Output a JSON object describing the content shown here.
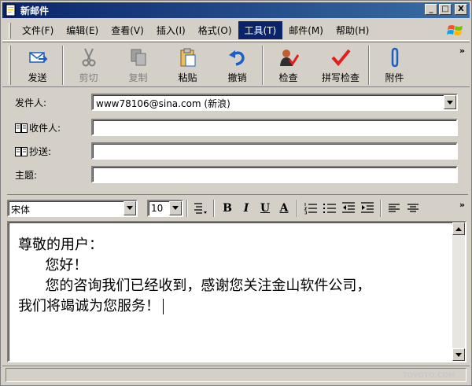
{
  "window": {
    "title": "新邮件",
    "controls": [
      "_",
      "□",
      "X"
    ]
  },
  "menu": [
    {
      "label": "文件(F)",
      "active": false
    },
    {
      "label": "编辑(E)",
      "active": false
    },
    {
      "label": "查看(V)",
      "active": false
    },
    {
      "label": "插入(I)",
      "active": false
    },
    {
      "label": "格式(O)",
      "active": false
    },
    {
      "label": "工具(T)",
      "active": true
    },
    {
      "label": "邮件(M)",
      "active": false
    },
    {
      "label": "帮助(H)",
      "active": false
    }
  ],
  "toolbar": {
    "send": "发送",
    "cut": "剪切",
    "copy": "复制",
    "paste": "粘贴",
    "undo": "撤销",
    "check": "检查",
    "spell": "拼写检查",
    "attach": "附件",
    "more": "»"
  },
  "fields": {
    "from_label": "发件人:",
    "from_value": "www78106@sina.com   (新浪)",
    "to_label": "收件人:",
    "to_value": "",
    "cc_label": "抄送:",
    "cc_value": "",
    "subject_label": "主题:",
    "subject_value": ""
  },
  "format": {
    "font": "宋体",
    "size": "10",
    "bold": "B",
    "italic": "I",
    "underline": "U",
    "color": "A",
    "more": "»"
  },
  "body": {
    "line1": "尊敬的用户：",
    "line2": "      您好！",
    "line3": "      您的咨询我们已经收到，感谢您关注金山软件公司，",
    "line4": "我们将竭诚为您服务！"
  },
  "watermark": "TOYOTO.COM",
  "colors": {
    "title_bar": "#0a246a",
    "menu_active": "#0a246a",
    "check_red": "#e0201c",
    "send_blue": "#1a5fc4"
  }
}
